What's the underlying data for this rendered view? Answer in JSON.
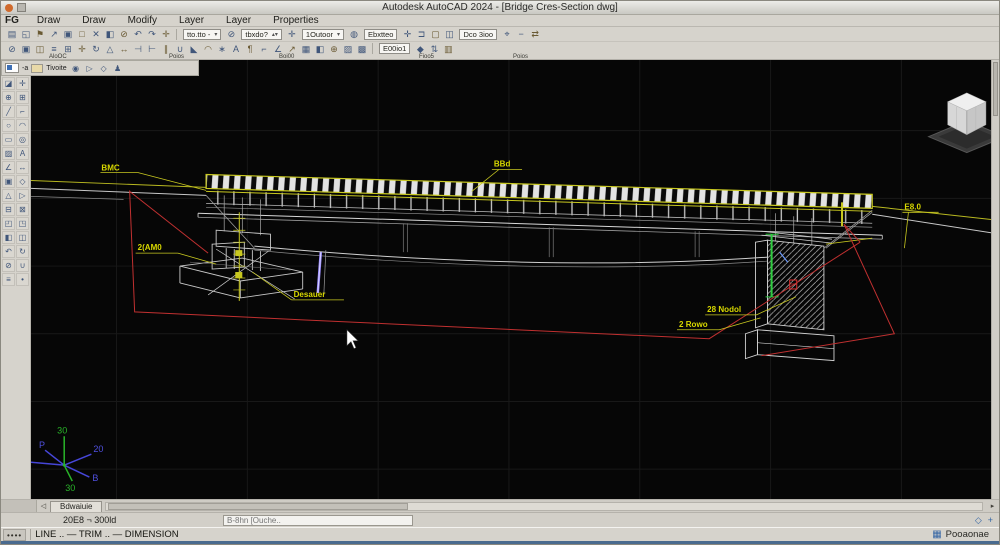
{
  "window": {
    "title": "Autodesk AutoCAD 2024 - [Bridge Cres-Section dwg]"
  },
  "menu": {
    "logo": "FG",
    "items": [
      "Draw",
      "Draw",
      "Modify",
      "Layer",
      "Layer",
      "Properties"
    ]
  },
  "toolbars": {
    "row1": {
      "icons_a": [
        {
          "n": "new-file",
          "g": "▤"
        },
        {
          "n": "open-folder",
          "g": "◱"
        },
        {
          "n": "flag",
          "g": "⚑"
        },
        {
          "n": "leader-arrow",
          "g": "↗"
        },
        {
          "n": "copy-clip",
          "g": "▣"
        },
        {
          "n": "paste",
          "g": "□"
        },
        {
          "n": "cut",
          "g": "✕"
        },
        {
          "n": "stamp",
          "g": "◧"
        },
        {
          "n": "erase",
          "g": "⊘"
        },
        {
          "n": "undo",
          "g": "↶"
        },
        {
          "n": "redo",
          "g": "↷"
        },
        {
          "n": "pan",
          "g": "✛"
        }
      ],
      "layer_combo": "tto.tto -",
      "icons_b": [
        {
          "n": "layer-off",
          "g": "⊘"
        }
      ],
      "style_combo": "tbxdo?",
      "icons_c": [
        {
          "n": "move-crosshair",
          "g": "✛"
        }
      ],
      "text_combo": "1Outoor",
      "icons_d": [
        {
          "n": "sphere",
          "g": "◍"
        }
      ],
      "dim_combo": "Ebxtteo",
      "icons_e": [
        {
          "n": "pan-all",
          "g": "✛"
        },
        {
          "n": "named-view",
          "g": "⊐"
        },
        {
          "n": "window",
          "g": "▢"
        },
        {
          "n": "viewport",
          "g": "◫"
        }
      ],
      "view_combo": "Dco 3ioo",
      "icons_f": [
        {
          "n": "object-snap",
          "g": "⌖"
        },
        {
          "n": "minus",
          "g": "−"
        },
        {
          "n": "ucs-swap",
          "g": "⇄"
        }
      ]
    },
    "row2": {
      "icons": [
        {
          "n": "erase",
          "g": "⊘"
        },
        {
          "n": "copy",
          "g": "▣"
        },
        {
          "n": "mirror",
          "g": "◫"
        },
        {
          "n": "offset",
          "g": "≡"
        },
        {
          "n": "array",
          "g": "⊞"
        },
        {
          "n": "move",
          "g": "✛"
        },
        {
          "n": "rotate",
          "g": "↻"
        },
        {
          "n": "scale",
          "g": "△"
        },
        {
          "n": "stretch",
          "g": "↔"
        },
        {
          "n": "trim",
          "g": "⊣"
        },
        {
          "n": "extend",
          "g": "⊢"
        },
        {
          "n": "break",
          "g": "∥"
        },
        {
          "n": "join",
          "g": "∪"
        },
        {
          "n": "chamfer",
          "g": "◣"
        },
        {
          "n": "fillet",
          "g": "◠"
        },
        {
          "n": "explode",
          "g": "∗"
        },
        {
          "n": "text",
          "g": "A"
        },
        {
          "n": "mtext",
          "g": "¶"
        },
        {
          "n": "dim-linear",
          "g": "⌐"
        },
        {
          "n": "dim-angular",
          "g": "∠"
        },
        {
          "n": "leader",
          "g": "↗"
        },
        {
          "n": "table",
          "g": "▦"
        },
        {
          "n": "block",
          "g": "◧"
        },
        {
          "n": "insert",
          "g": "⊕"
        },
        {
          "n": "hatch",
          "g": "▨"
        },
        {
          "n": "gradient",
          "g": "▩"
        }
      ],
      "edit_combo": "E00io1",
      "icons_b": [
        {
          "n": "properties",
          "g": "◆"
        },
        {
          "n": "sync",
          "g": "⇅"
        },
        {
          "n": "layers-panel",
          "g": "▥"
        }
      ],
      "group_labels": [
        "AloOC",
        "Poios",
        "Boi00",
        "Fioo5",
        "Poios"
      ]
    }
  },
  "canvas_toolbar": {
    "chip_label": "-a",
    "layer_label": "Tivoite",
    "icons": [
      {
        "n": "visibility",
        "g": "◉"
      },
      {
        "n": "plot-triangle",
        "g": "▷"
      },
      {
        "n": "layer-state",
        "g": "◇"
      },
      {
        "n": "user",
        "g": "♟"
      }
    ]
  },
  "palette": {
    "icons": [
      {
        "n": "select",
        "g": "◪"
      },
      {
        "n": "pan",
        "g": "✛"
      },
      {
        "n": "zoom-in",
        "g": "⊕"
      },
      {
        "n": "zoom-grid",
        "g": "⊞"
      },
      {
        "n": "line",
        "g": "╱"
      },
      {
        "n": "polyline",
        "g": "⌐"
      },
      {
        "n": "circle",
        "g": "○"
      },
      {
        "n": "arc",
        "g": "◠"
      },
      {
        "n": "rectangle",
        "g": "▭"
      },
      {
        "n": "ellipse",
        "g": "◎"
      },
      {
        "n": "hatch",
        "g": "▨"
      },
      {
        "n": "text",
        "g": "A"
      },
      {
        "n": "angle",
        "g": "∠"
      },
      {
        "n": "stretch",
        "g": "↔"
      },
      {
        "n": "copy",
        "g": "▣"
      },
      {
        "n": "diamond",
        "g": "◇"
      },
      {
        "n": "triangle",
        "g": "△"
      },
      {
        "n": "play",
        "g": "▷"
      },
      {
        "n": "minus-box",
        "g": "⊟"
      },
      {
        "n": "close-box",
        "g": "⊠"
      },
      {
        "n": "region",
        "g": "◰"
      },
      {
        "n": "viewport",
        "g": "◳"
      },
      {
        "n": "block",
        "g": "◧"
      },
      {
        "n": "mirror",
        "g": "◫"
      },
      {
        "n": "undo",
        "g": "↶"
      },
      {
        "n": "redo",
        "g": "↻"
      },
      {
        "n": "erase",
        "g": "⊘"
      },
      {
        "n": "join",
        "g": "∪"
      },
      {
        "n": "offset",
        "g": "≡"
      },
      {
        "n": "point",
        "g": "•"
      }
    ]
  },
  "drawing": {
    "labels": {
      "bmc": "BMC",
      "bbd": "BBd",
      "e80": "E8.0",
      "amo": "2(AM0",
      "desauer": "Desauer",
      "nodol": "28 Nodol",
      "rowo": "2 Rowo"
    }
  },
  "ucs": {
    "top": "30",
    "p": "P",
    "right": "20",
    "left": "B",
    "br": "B",
    "bottom": "30"
  },
  "model_tabs": {
    "tab": "Bdwaiuie",
    "left_arrow": "◁",
    "right_arrow": "▸"
  },
  "command": {
    "history": "20E8 ¬ 300ld",
    "input_placeholder": "B-8hn [Ouche..",
    "diamond_icon": "◇",
    "plus_icon": "+"
  },
  "statusbar": {
    "dots": "••••",
    "modes": "LINE .. — TRIM .. — DIMENSION",
    "grid_icon": "▦",
    "right_label": "Pooaonae"
  },
  "colors": {
    "canvas_black": "#060606",
    "line_white": "#cfcfcf",
    "line_yellow": "#c8c820",
    "line_red": "#c03030",
    "line_green": "#2ecc40",
    "line_purple": "#9b8cff"
  }
}
